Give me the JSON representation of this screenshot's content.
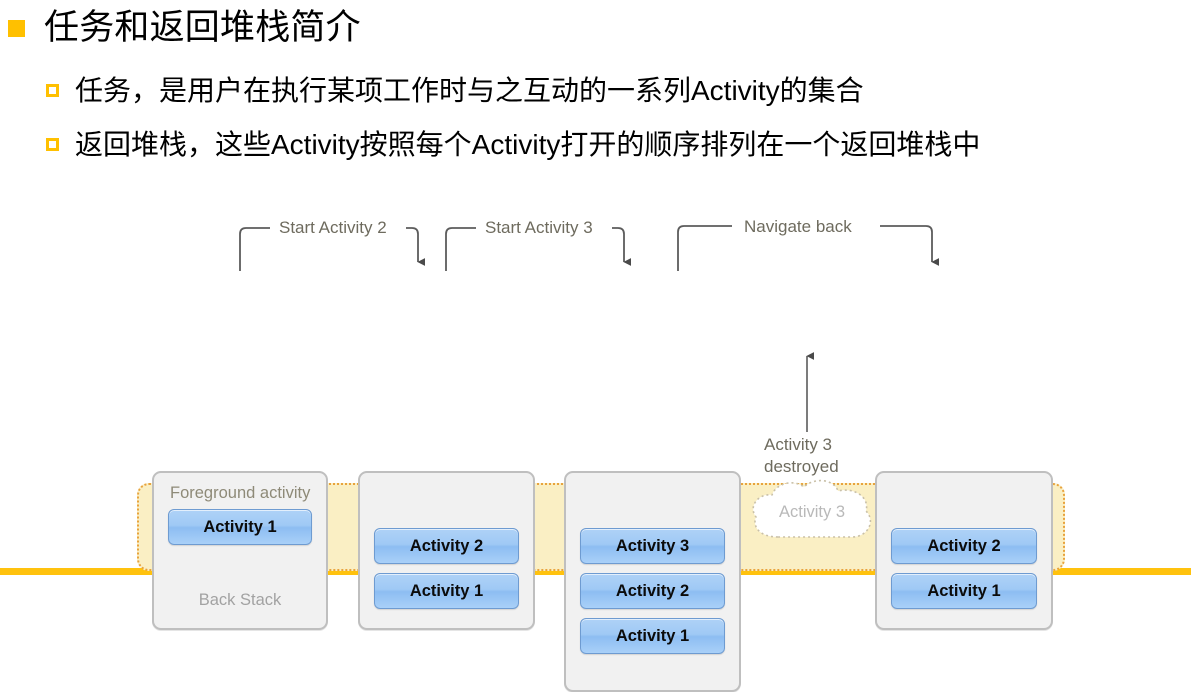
{
  "slide": {
    "heading": "任务和返回堆栈简介",
    "bullets": [
      "任务，是用户在执行某项工作时与之互动的一系列Activity的集合",
      "返回堆栈，这些Activity按照每个Activity打开的顺序排列在一个返回堆栈中"
    ]
  },
  "diagram": {
    "band_label": "Foreground activity",
    "back_stack_label": "Back Stack",
    "cloud_label": "Activity 3",
    "stacks": [
      {
        "id": "stack-1",
        "chips": [
          "Activity 1"
        ]
      },
      {
        "id": "stack-2",
        "chips": [
          "Activity 2",
          "Activity 1"
        ]
      },
      {
        "id": "stack-3",
        "chips": [
          "Activity 3",
          "Activity 2",
          "Activity 1"
        ]
      },
      {
        "id": "stack-4",
        "chips": [
          "Activity 2",
          "Activity 1"
        ]
      }
    ],
    "annotations": [
      "Start Activity 2",
      "Start Activity 3",
      "Navigate back",
      "Activity 3 destroyed"
    ]
  },
  "colors": {
    "accent_orange": "#FFC000",
    "footer_rule": "#FFC20E",
    "band_fill": "#FAEFC4",
    "band_border": "#E8A33D",
    "chip_blue": "#9FC9F5",
    "stack_bg": "#F1F1F1",
    "stack_border": "#BFBFBF",
    "annotation_text": "#6E6B5E"
  }
}
